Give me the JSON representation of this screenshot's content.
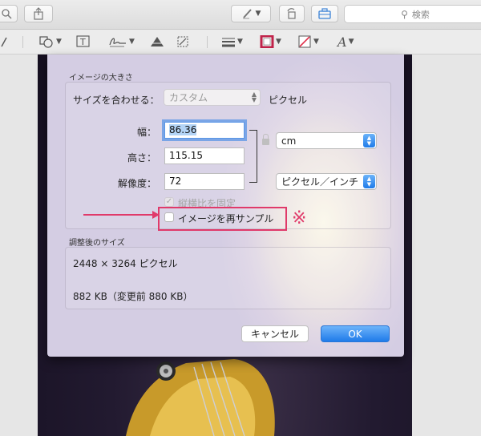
{
  "toolbar": {
    "search_placeholder": "検索",
    "search_icon": "magnifier-icon",
    "icons": [
      "zoom-icon",
      "share-icon",
      "pen-icon",
      "rotate-icon",
      "toolbox-icon"
    ]
  },
  "markup": {
    "tools": [
      "select-icon",
      "shapes-icon",
      "text-icon",
      "sign-icon",
      "adjust-color-icon",
      "adjust-size-icon",
      "line-style-icon",
      "border-color-icon",
      "fill-color-icon",
      "font-icon"
    ],
    "font_glyph": "A",
    "border_color": "#c0234a",
    "fill_color_slash": "#e0304a"
  },
  "dialog": {
    "image_size_label": "イメージの大きさ",
    "fit_label": "サイズを合わせる：",
    "fit_value": "カスタム",
    "fit_unit": "ピクセル",
    "width_label": "幅：",
    "width_value": "86.36",
    "height_label": "高さ：",
    "height_value": "115.15",
    "resolution_label": "解像度：",
    "resolution_value": "72",
    "size_unit": "cm",
    "resolution_unit": "ピクセル／インチ",
    "scale_prop_label": "縦横比を固定",
    "resample_label": "イメージを再サンプル",
    "resulting_label": "調整後のサイズ",
    "result_pixels": "2448 × 3264 ピクセル",
    "result_filesize": "882 KB（変更前 880 KB）",
    "cancel_label": "キャンセル",
    "ok_label": "OK"
  },
  "annotation": {
    "mark": "※",
    "color": "#e03a6a"
  }
}
